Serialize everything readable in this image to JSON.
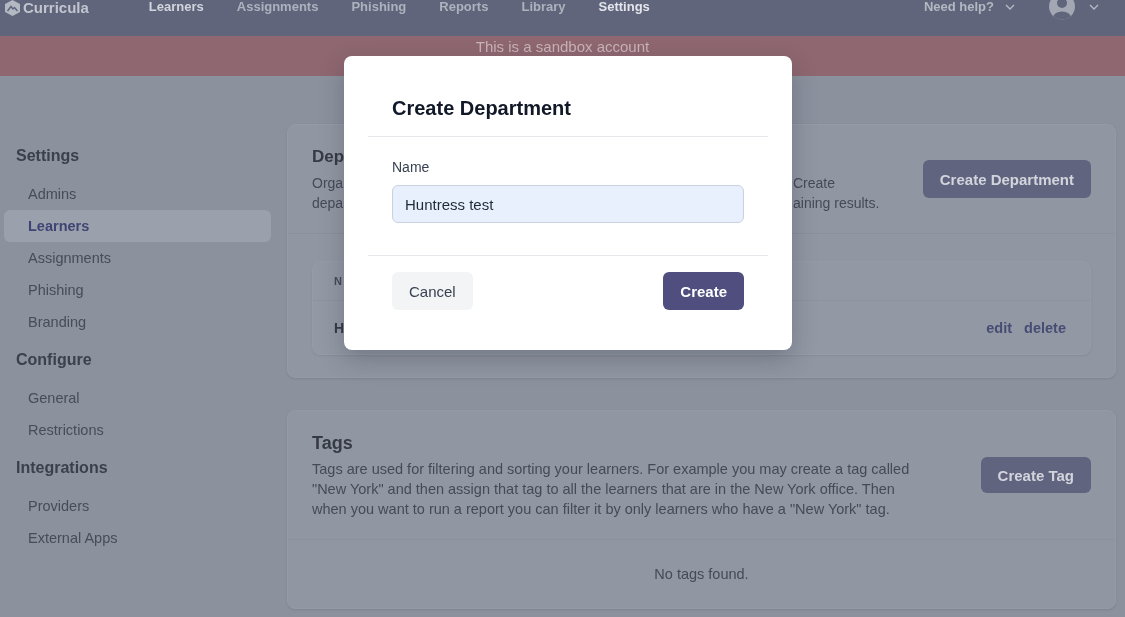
{
  "top_nav": {
    "logo": "Curricula",
    "items": [
      {
        "label": "Learners",
        "selected": false,
        "hovered": true
      },
      {
        "label": "Assignments",
        "selected": false,
        "hovered": false
      },
      {
        "label": "Phishing",
        "selected": false,
        "hovered": false
      },
      {
        "label": "Reports",
        "selected": false,
        "hovered": false
      },
      {
        "label": "Library",
        "selected": false,
        "hovered": false
      },
      {
        "label": "Settings",
        "selected": true,
        "hovered": false
      }
    ],
    "help": "Need help?"
  },
  "banner": {
    "text": "This is a sandbox account"
  },
  "sidebar": {
    "sections": [
      {
        "title": "Settings",
        "items": [
          {
            "label": "Admins",
            "selected": false
          },
          {
            "label": "Learners",
            "selected": true
          },
          {
            "label": "Assignments",
            "selected": false
          },
          {
            "label": "Phishing",
            "selected": false
          },
          {
            "label": "Branding",
            "selected": false
          }
        ]
      },
      {
        "title": "Configure",
        "items": [
          {
            "label": "General",
            "selected": false
          },
          {
            "label": "Restrictions",
            "selected": false
          }
        ]
      },
      {
        "title": "Integrations",
        "items": [
          {
            "label": "Providers",
            "selected": false
          },
          {
            "label": "External Apps",
            "selected": false
          }
        ]
      }
    ]
  },
  "departments_card": {
    "title": "Dep",
    "description_lines": [
      {
        "left": "Orga",
        "right": "Create"
      },
      {
        "left": "depa",
        "right": "aining results."
      }
    ],
    "button": "Create Department",
    "table": {
      "columns": [
        "N"
      ],
      "rows": [
        {
          "name": "H",
          "actions": [
            "edit",
            "delete"
          ]
        }
      ]
    }
  },
  "tags_card": {
    "title": "Tags",
    "description": "Tags are used for filtering and sorting your learners. For example you may create a tag called \"New York\" and then assign that tag to all the learners that are in the New York office. Then when you want to run a report you can filter it by only learners who have a \"New York\" tag.",
    "button": "Create Tag",
    "empty_text": "No tags found."
  },
  "modal": {
    "title": "Create Department",
    "field": {
      "label": "Name",
      "value": "Huntress test"
    },
    "buttons": [
      {
        "label": "Cancel",
        "kind": "secondary"
      },
      {
        "label": "Create",
        "kind": "primary"
      }
    ]
  }
}
